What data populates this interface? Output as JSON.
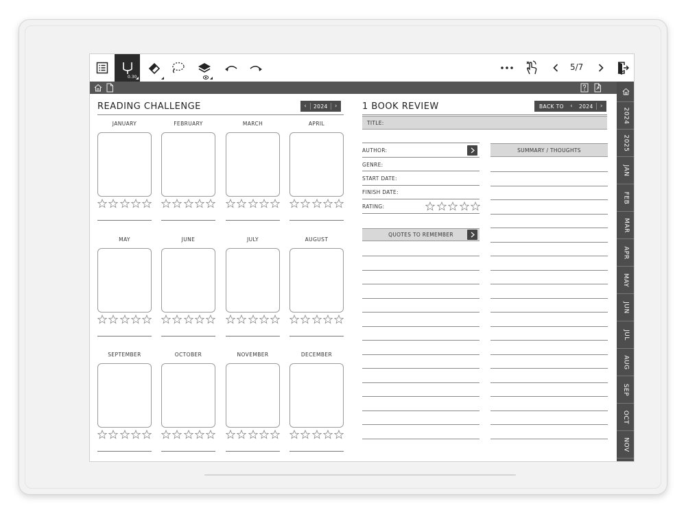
{
  "toolbar": {
    "pen_size": "0.30",
    "page_indicator": "5/7"
  },
  "side_tabs": [
    "2024",
    "2025",
    "JAN",
    "FEB",
    "MAR",
    "APR",
    "MAY",
    "JUN",
    "JUL",
    "AUG",
    "SEP",
    "OCT",
    "NOV"
  ],
  "reading_challenge": {
    "title": "READING CHALLENGE",
    "year": "2024",
    "months": [
      "JANUARY",
      "FEBRUARY",
      "MARCH",
      "APRIL",
      "MAY",
      "JUNE",
      "JULY",
      "AUGUST",
      "SEPTEMBER",
      "OCTOBER",
      "NOVEMBER",
      "DECEMBER"
    ]
  },
  "book_review": {
    "title": "1 BOOK REVIEW",
    "back_label": "BACK TO",
    "year": "2024",
    "title_field": "TITLE:",
    "author": "AUTHOR:",
    "genre": "GENRE:",
    "start_date": "START DATE:",
    "finish_date": "FINISH DATE:",
    "rating": "RATING:",
    "quotes_header": "QUOTES TO REMEMBER",
    "summary_header": "SUMMARY / THOUGHTS"
  },
  "colors": {
    "toolbar_active": "#2b2b2b",
    "nav_strip": "#555555",
    "side_tabs": "#4d4d4d",
    "field_bar": "#d8d8d8"
  }
}
